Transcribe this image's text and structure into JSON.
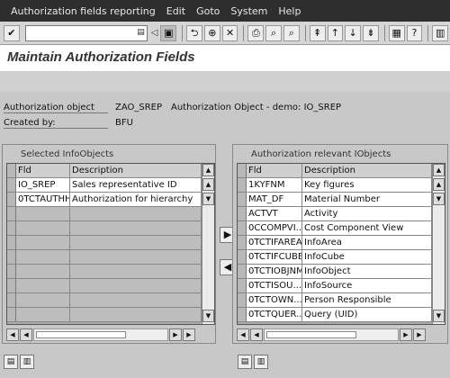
{
  "menu": [
    "Authorization fields reporting",
    "Edit",
    "Goto",
    "System",
    "Help"
  ],
  "title": "Maintain Authorization Fields",
  "header": {
    "object_label": "Authorization object",
    "object_value": "ZAO_SREP",
    "object_desc": "Authorization Object - demo: IO_SREP",
    "created_label": "Created by:",
    "created_value": "BFU"
  },
  "left_panel": {
    "title": "Selected InfoObjects",
    "columns": [
      "Fld",
      "Description"
    ],
    "rows": [
      [
        "IO_SREP",
        "Sales representative ID"
      ],
      [
        "0TCTAUTHH",
        "Authorization for hierarchy"
      ]
    ]
  },
  "right_panel": {
    "title": "Authorization relevant IObjects",
    "columns": [
      "Fld",
      "Description"
    ],
    "rows": [
      [
        "1KYFNM",
        "Key figures"
      ],
      [
        "MAT_DF",
        "Material Number"
      ],
      [
        "ACTVT",
        "Activity"
      ],
      [
        "0CCOMPVI...",
        "Cost Component View"
      ],
      [
        "0TCTIFAREA",
        "InfoArea"
      ],
      [
        "0TCTIFCUBE",
        "InfoCube"
      ],
      [
        "0TCTIOBJNM",
        "InfoObject"
      ],
      [
        "0TCTISOU...",
        "InfoSource"
      ],
      [
        "0TCTOWN...",
        "Person Responsible"
      ],
      [
        "0TCTQUER...",
        "Query (UID)"
      ]
    ]
  }
}
